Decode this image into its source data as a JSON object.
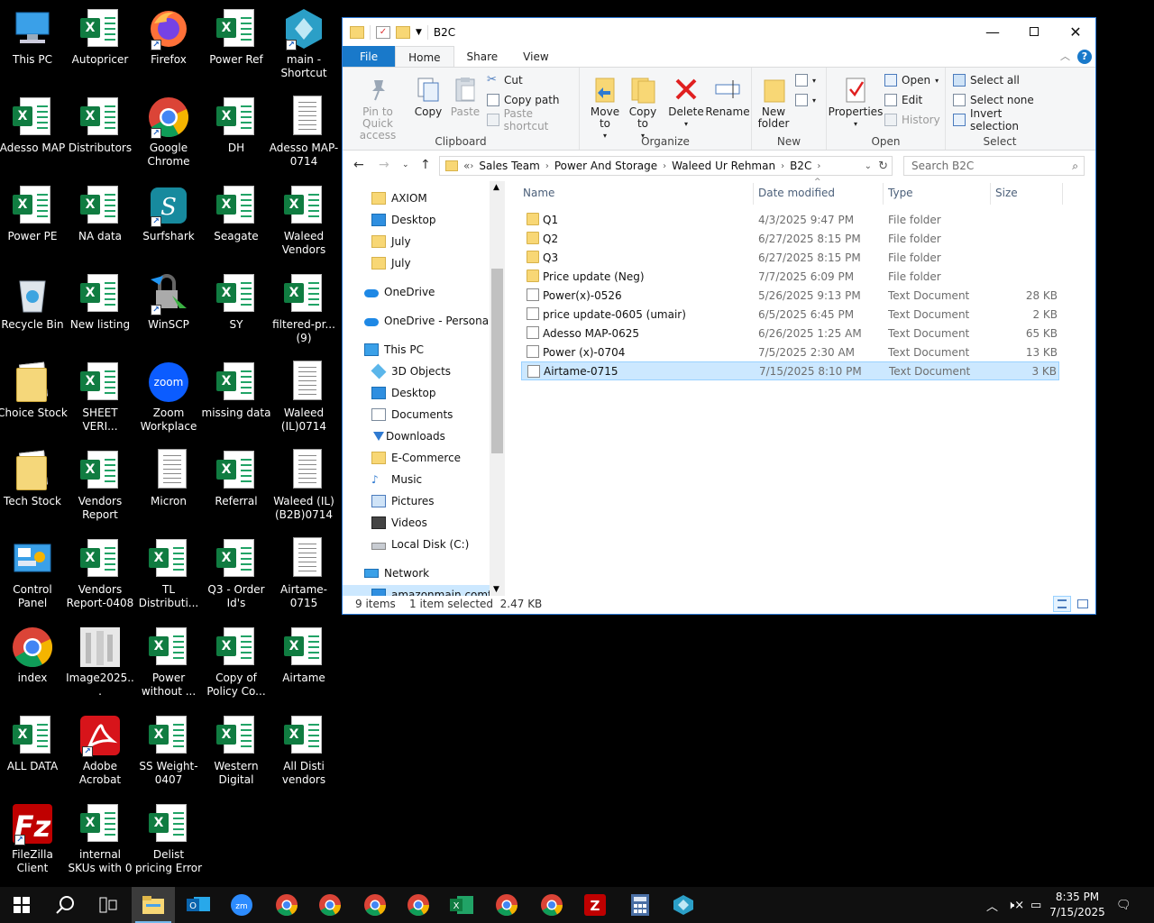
{
  "desktop": {
    "icons": [
      {
        "label": "This PC",
        "type": "pc"
      },
      {
        "label": "Autopricer",
        "type": "xl"
      },
      {
        "label": "Firefox",
        "type": "firefox"
      },
      {
        "label": "Power Ref",
        "type": "xl"
      },
      {
        "label": "main - Shortcut",
        "type": "app"
      },
      {
        "label": "Adesso MAP",
        "type": "xl"
      },
      {
        "label": "Distributors",
        "type": "xl"
      },
      {
        "label": "Google Chrome",
        "type": "chrome"
      },
      {
        "label": "DH",
        "type": "xl"
      },
      {
        "label": "Adesso MAP-0714",
        "type": "txt"
      },
      {
        "label": "Power PE",
        "type": "xl"
      },
      {
        "label": "NA data",
        "type": "xl"
      },
      {
        "label": "Surfshark",
        "type": "surfshark"
      },
      {
        "label": "Seagate",
        "type": "xl"
      },
      {
        "label": "Waleed Vendors",
        "type": "xl"
      },
      {
        "label": "Recycle Bin",
        "type": "bin"
      },
      {
        "label": "New listing",
        "type": "xl"
      },
      {
        "label": "WinSCP",
        "type": "winscp"
      },
      {
        "label": "SY",
        "type": "xl"
      },
      {
        "label": "filtered-pr... (9)",
        "type": "xl"
      },
      {
        "label": "Choice Stock",
        "type": "folder"
      },
      {
        "label": "SHEET VERI...",
        "type": "xl"
      },
      {
        "label": "Zoom Workplace",
        "type": "zoom"
      },
      {
        "label": "missing data",
        "type": "xl"
      },
      {
        "label": "Waleed (IL)0714",
        "type": "txt"
      },
      {
        "label": "Tech Stock",
        "type": "folder"
      },
      {
        "label": "Vendors Report",
        "type": "xl"
      },
      {
        "label": "Micron",
        "type": "txt"
      },
      {
        "label": "Referral",
        "type": "xl"
      },
      {
        "label": "Waleed (IL)(B2B)0714",
        "type": "txt"
      },
      {
        "label": "Control Panel",
        "type": "cpanel"
      },
      {
        "label": "Vendors Report-0408",
        "type": "xl"
      },
      {
        "label": "TL Distributi...",
        "type": "xl"
      },
      {
        "label": "Q3 - Order Id's",
        "type": "xl"
      },
      {
        "label": "Airtame-0715",
        "type": "txt"
      },
      {
        "label": "index",
        "type": "chrome"
      },
      {
        "label": "Image2025...",
        "type": "image"
      },
      {
        "label": "Power without ...",
        "type": "xl"
      },
      {
        "label": "Copy of Policy Co...",
        "type": "xl"
      },
      {
        "label": "Airtame",
        "type": "xl"
      },
      {
        "label": "ALL DATA",
        "type": "xl"
      },
      {
        "label": "Adobe Acrobat",
        "type": "acrobat"
      },
      {
        "label": "SS Weight-0407",
        "type": "xl"
      },
      {
        "label": "Western Digital",
        "type": "xl"
      },
      {
        "label": "All Disti vendors",
        "type": "xl"
      },
      {
        "label": "FileZilla Client",
        "type": "filezilla"
      },
      {
        "label": "internal SKUs with 0",
        "type": "xl"
      },
      {
        "label": "Delist pricing Error",
        "type": "xl"
      }
    ]
  },
  "explorer": {
    "title": "B2C",
    "tabs": {
      "file": "File",
      "home": "Home",
      "share": "Share",
      "view": "View"
    },
    "ribbon": {
      "clipboard": {
        "group": "Clipboard",
        "pin": "Pin to Quick access",
        "copy": "Copy",
        "paste": "Paste",
        "cut": "Cut",
        "copy_path": "Copy path",
        "paste_shortcut": "Paste shortcut"
      },
      "organize": {
        "group": "Organize",
        "move_to": "Move to",
        "copy_to": "Copy to",
        "delete": "Delete",
        "rename": "Rename"
      },
      "new": {
        "group": "New",
        "new_folder": "New folder"
      },
      "open": {
        "group": "Open",
        "properties": "Properties",
        "open": "Open",
        "edit": "Edit",
        "history": "History"
      },
      "select": {
        "group": "Select",
        "select_all": "Select all",
        "select_none": "Select none",
        "invert": "Invert selection"
      }
    },
    "address": {
      "prefix": "«",
      "crumbs": [
        "Sales Team",
        "Power And Storage",
        "Waleed Ur Rehman",
        "B2C"
      ],
      "search_placeholder": "Search B2C"
    },
    "nav": [
      {
        "label": "AXIOM",
        "icon": "folder"
      },
      {
        "label": "Desktop",
        "icon": "desktop"
      },
      {
        "label": "July",
        "icon": "folder"
      },
      {
        "label": "July",
        "icon": "folder"
      },
      {
        "label": "OneDrive",
        "icon": "cloud"
      },
      {
        "label": "OneDrive - Personal",
        "icon": "cloud"
      },
      {
        "label": "This PC",
        "icon": "pc"
      },
      {
        "label": "3D Objects",
        "icon": "cube"
      },
      {
        "label": "Desktop",
        "icon": "desktop"
      },
      {
        "label": "Documents",
        "icon": "docs"
      },
      {
        "label": "Downloads",
        "icon": "download"
      },
      {
        "label": "E-Commerce",
        "icon": "folder"
      },
      {
        "label": "Music",
        "icon": "music"
      },
      {
        "label": "Pictures",
        "icon": "pictures"
      },
      {
        "label": "Videos",
        "icon": "videos"
      },
      {
        "label": "Local Disk (C:)",
        "icon": "disk"
      },
      {
        "label": "Network",
        "icon": "network"
      },
      {
        "label": "amazonmain.comtar",
        "icon": "desktop"
      }
    ],
    "columns": {
      "name": "Name",
      "date": "Date modified",
      "type": "Type",
      "size": "Size"
    },
    "files": [
      {
        "name": "Q1",
        "date": "4/3/2025 9:47 PM",
        "type": "File folder",
        "size": "",
        "kind": "folder"
      },
      {
        "name": "Q2",
        "date": "6/27/2025 8:15 PM",
        "type": "File folder",
        "size": "",
        "kind": "folder"
      },
      {
        "name": "Q3",
        "date": "6/27/2025 8:15 PM",
        "type": "File folder",
        "size": "",
        "kind": "folder"
      },
      {
        "name": "Price update (Neg)",
        "date": "7/7/2025 6:09 PM",
        "type": "File folder",
        "size": "",
        "kind": "folder"
      },
      {
        "name": "Power(x)-0526",
        "date": "5/26/2025 9:13 PM",
        "type": "Text Document",
        "size": "28 KB",
        "kind": "txt"
      },
      {
        "name": "price update-0605 (umair)",
        "date": "6/5/2025 6:45 PM",
        "type": "Text Document",
        "size": "2 KB",
        "kind": "txt"
      },
      {
        "name": "Adesso MAP-0625",
        "date": "6/26/2025 1:25 AM",
        "type": "Text Document",
        "size": "65 KB",
        "kind": "txt"
      },
      {
        "name": "Power (x)-0704",
        "date": "7/5/2025 2:30 AM",
        "type": "Text Document",
        "size": "13 KB",
        "kind": "txt"
      },
      {
        "name": "Airtame-0715",
        "date": "7/15/2025 8:10 PM",
        "type": "Text Document",
        "size": "3 KB",
        "kind": "txt",
        "selected": true
      }
    ],
    "status": {
      "items": "9 items",
      "selected": "1 item selected  2.47 KB"
    }
  },
  "taskbar": {
    "time": "8:35 PM",
    "date": "7/15/2025",
    "apps": [
      "start-icon",
      "search-icon",
      "task-view-icon",
      "file-explorer-icon",
      "outlook-icon",
      "zoom-icon",
      "chrome-icon",
      "chrome-icon",
      "chrome-icon",
      "chrome-icon",
      "excel-icon",
      "chrome-icon",
      "chrome-icon",
      "filezilla-icon",
      "calculator-icon",
      "app-icon"
    ]
  },
  "colors": {
    "accent": "#1979ca",
    "selection": "#cce8ff",
    "excel": "#107c41",
    "folder": "#f8d775"
  }
}
